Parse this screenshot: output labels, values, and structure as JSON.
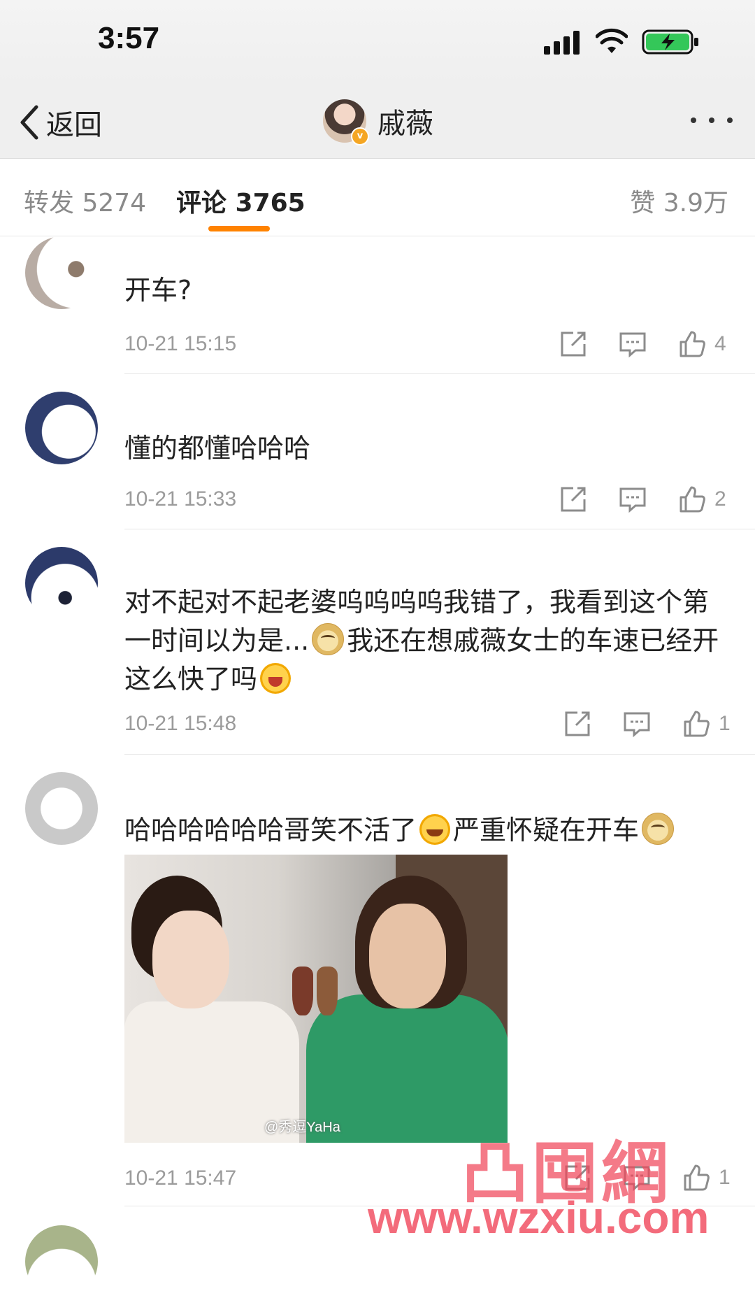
{
  "status_bar": {
    "time": "3:57"
  },
  "nav": {
    "back_label": "返回",
    "profile_name": "戚薇",
    "verified_badge": "v"
  },
  "tabs": {
    "forward": "转发 5274",
    "comment": "评论 3765",
    "like": "赞 3.9万",
    "active": "comment"
  },
  "comments": [
    {
      "text": "开车?",
      "time": "10-21 15:15",
      "likes": "4"
    },
    {
      "text": "懂的都懂哈哈哈",
      "time": "10-21 15:33",
      "likes": "2"
    },
    {
      "text_parts": [
        "对不起对不起老婆呜呜呜呜我错了，我看到这个第一时间以为是...",
        "我还在想戚薇女士的车速已经开这么快了吗"
      ],
      "emojis": [
        "doge-emoji",
        "crying-emoji"
      ],
      "time": "10-21 15:48",
      "likes": "1"
    },
    {
      "text_parts": [
        "哈哈哈哈哈哈哥笑不活了",
        "严重怀疑在开车"
      ],
      "emojis": [
        "laugh-cry-emoji",
        "doge-emoji"
      ],
      "image_caption": "@秀逗YaHa",
      "time": "10-21 15:47",
      "likes": "1"
    }
  ],
  "watermark": {
    "logo": "凸囤網",
    "url": "www.wzxiu.com"
  },
  "colors": {
    "accent": "#ff8200",
    "watermark": "#f0465a",
    "meta_gray": "#9b9b9b"
  }
}
